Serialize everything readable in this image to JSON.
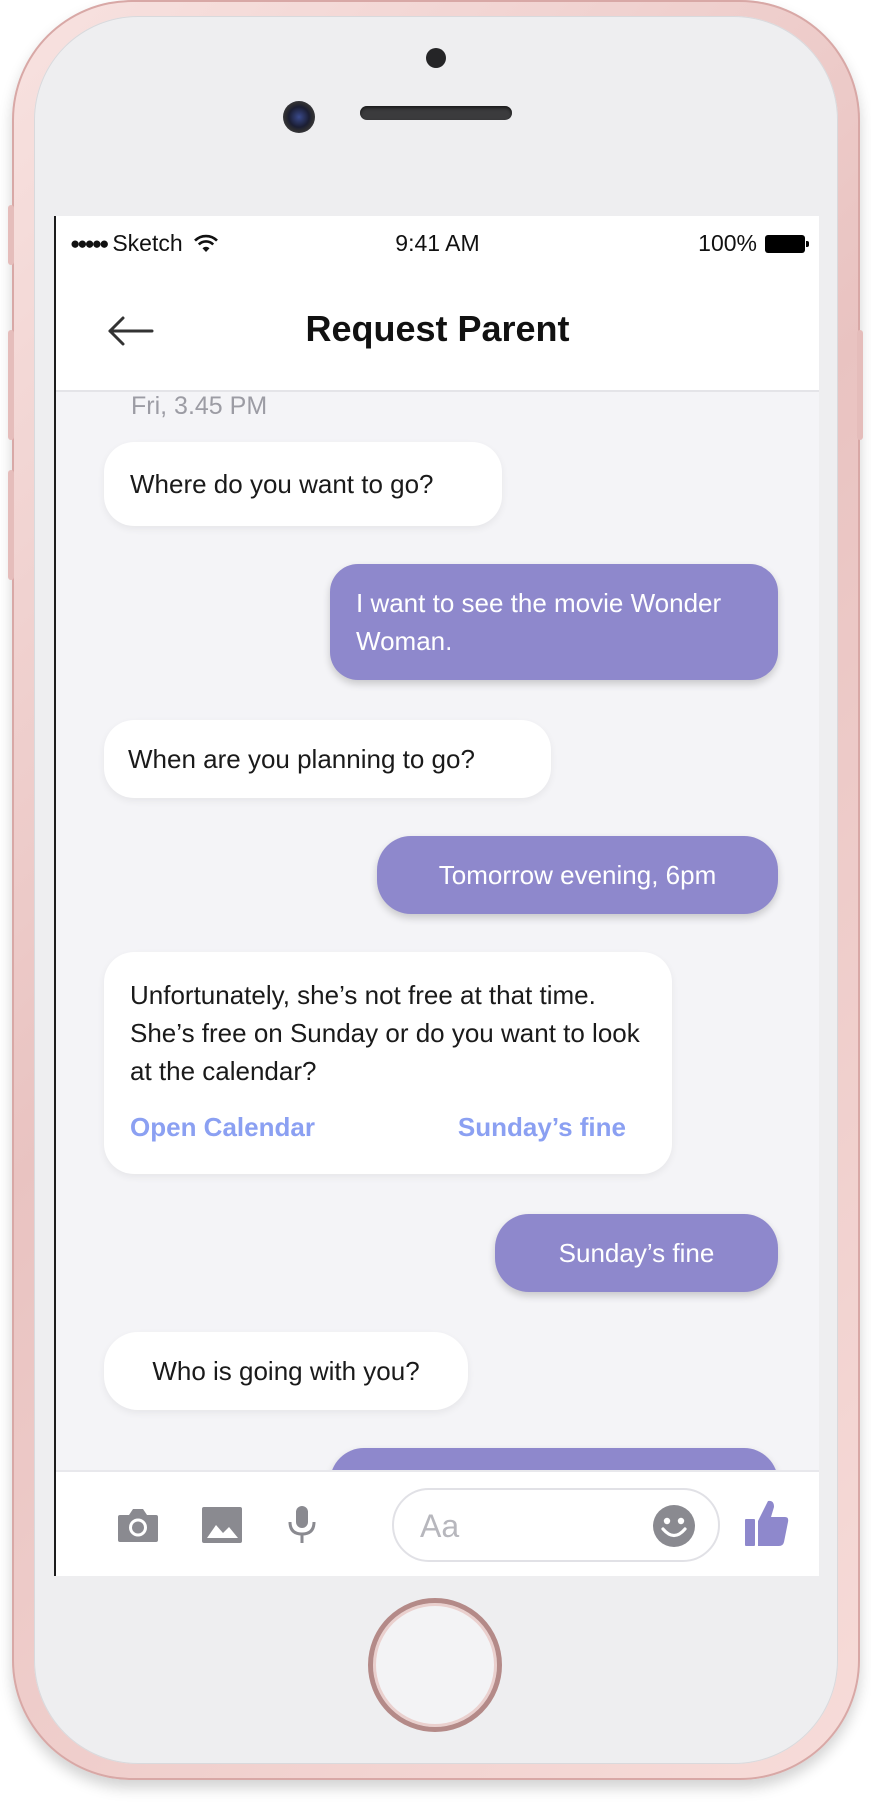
{
  "status_bar": {
    "carrier": "Sketch",
    "signal_dots": "●●●●●",
    "time": "9:41 AM",
    "battery": "100%"
  },
  "header": {
    "title": "Request Parent",
    "back_icon": "arrow-left-icon"
  },
  "chat": {
    "timestamp": "Fri, 3.45 PM",
    "messages": [
      {
        "direction": "incoming",
        "text": "Where do you want to go?"
      },
      {
        "direction": "outgoing",
        "text": "I want to see the movie Wonder Woman."
      },
      {
        "direction": "incoming",
        "text": "When are you planning to go?"
      },
      {
        "direction": "outgoing",
        "text": "Tomorrow evening,  6pm"
      },
      {
        "direction": "incoming",
        "text": "Unfortunately, she’s not free at that time. She’s free on Sunday or do you want to look at the calendar?",
        "actions": [
          "Open Calendar",
          "Sunday’s fine"
        ]
      },
      {
        "direction": "outgoing",
        "text": "Sunday’s fine"
      },
      {
        "direction": "incoming",
        "text": "Who is going with you?"
      },
      {
        "direction": "outgoing",
        "text": ""
      }
    ]
  },
  "composer": {
    "placeholder": "Aa",
    "icons": [
      "camera-icon",
      "image-icon",
      "microphone-icon",
      "emoji-icon",
      "thumbs-up-icon"
    ]
  },
  "colors": {
    "outgoing_bubble": "#8e88cc",
    "link": "#8ba0f2",
    "thumbs_up": "#8e88cc"
  }
}
